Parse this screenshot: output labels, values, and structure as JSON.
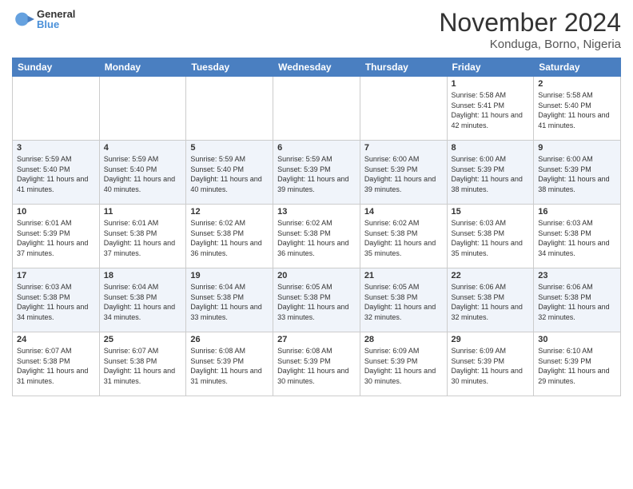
{
  "header": {
    "logo": {
      "general": "General",
      "blue": "Blue"
    },
    "title": "November 2024",
    "location": "Konduga, Borno, Nigeria"
  },
  "weekdays": [
    "Sunday",
    "Monday",
    "Tuesday",
    "Wednesday",
    "Thursday",
    "Friday",
    "Saturday"
  ],
  "weeks": [
    [
      {
        "day": "",
        "empty": true
      },
      {
        "day": "",
        "empty": true
      },
      {
        "day": "",
        "empty": true
      },
      {
        "day": "",
        "empty": true
      },
      {
        "day": "",
        "empty": true
      },
      {
        "day": "1",
        "sunrise": "5:58 AM",
        "sunset": "5:41 PM",
        "daylight": "11 hours and 42 minutes."
      },
      {
        "day": "2",
        "sunrise": "5:58 AM",
        "sunset": "5:40 PM",
        "daylight": "11 hours and 41 minutes."
      }
    ],
    [
      {
        "day": "3",
        "sunrise": "5:59 AM",
        "sunset": "5:40 PM",
        "daylight": "11 hours and 41 minutes."
      },
      {
        "day": "4",
        "sunrise": "5:59 AM",
        "sunset": "5:40 PM",
        "daylight": "11 hours and 40 minutes."
      },
      {
        "day": "5",
        "sunrise": "5:59 AM",
        "sunset": "5:40 PM",
        "daylight": "11 hours and 40 minutes."
      },
      {
        "day": "6",
        "sunrise": "5:59 AM",
        "sunset": "5:39 PM",
        "daylight": "11 hours and 39 minutes."
      },
      {
        "day": "7",
        "sunrise": "6:00 AM",
        "sunset": "5:39 PM",
        "daylight": "11 hours and 39 minutes."
      },
      {
        "day": "8",
        "sunrise": "6:00 AM",
        "sunset": "5:39 PM",
        "daylight": "11 hours and 38 minutes."
      },
      {
        "day": "9",
        "sunrise": "6:00 AM",
        "sunset": "5:39 PM",
        "daylight": "11 hours and 38 minutes."
      }
    ],
    [
      {
        "day": "10",
        "sunrise": "6:01 AM",
        "sunset": "5:39 PM",
        "daylight": "11 hours and 37 minutes."
      },
      {
        "day": "11",
        "sunrise": "6:01 AM",
        "sunset": "5:38 PM",
        "daylight": "11 hours and 37 minutes."
      },
      {
        "day": "12",
        "sunrise": "6:02 AM",
        "sunset": "5:38 PM",
        "daylight": "11 hours and 36 minutes."
      },
      {
        "day": "13",
        "sunrise": "6:02 AM",
        "sunset": "5:38 PM",
        "daylight": "11 hours and 36 minutes."
      },
      {
        "day": "14",
        "sunrise": "6:02 AM",
        "sunset": "5:38 PM",
        "daylight": "11 hours and 35 minutes."
      },
      {
        "day": "15",
        "sunrise": "6:03 AM",
        "sunset": "5:38 PM",
        "daylight": "11 hours and 35 minutes."
      },
      {
        "day": "16",
        "sunrise": "6:03 AM",
        "sunset": "5:38 PM",
        "daylight": "11 hours and 34 minutes."
      }
    ],
    [
      {
        "day": "17",
        "sunrise": "6:03 AM",
        "sunset": "5:38 PM",
        "daylight": "11 hours and 34 minutes."
      },
      {
        "day": "18",
        "sunrise": "6:04 AM",
        "sunset": "5:38 PM",
        "daylight": "11 hours and 34 minutes."
      },
      {
        "day": "19",
        "sunrise": "6:04 AM",
        "sunset": "5:38 PM",
        "daylight": "11 hours and 33 minutes."
      },
      {
        "day": "20",
        "sunrise": "6:05 AM",
        "sunset": "5:38 PM",
        "daylight": "11 hours and 33 minutes."
      },
      {
        "day": "21",
        "sunrise": "6:05 AM",
        "sunset": "5:38 PM",
        "daylight": "11 hours and 32 minutes."
      },
      {
        "day": "22",
        "sunrise": "6:06 AM",
        "sunset": "5:38 PM",
        "daylight": "11 hours and 32 minutes."
      },
      {
        "day": "23",
        "sunrise": "6:06 AM",
        "sunset": "5:38 PM",
        "daylight": "11 hours and 32 minutes."
      }
    ],
    [
      {
        "day": "24",
        "sunrise": "6:07 AM",
        "sunset": "5:38 PM",
        "daylight": "11 hours and 31 minutes."
      },
      {
        "day": "25",
        "sunrise": "6:07 AM",
        "sunset": "5:38 PM",
        "daylight": "11 hours and 31 minutes."
      },
      {
        "day": "26",
        "sunrise": "6:08 AM",
        "sunset": "5:39 PM",
        "daylight": "11 hours and 31 minutes."
      },
      {
        "day": "27",
        "sunrise": "6:08 AM",
        "sunset": "5:39 PM",
        "daylight": "11 hours and 30 minutes."
      },
      {
        "day": "28",
        "sunrise": "6:09 AM",
        "sunset": "5:39 PM",
        "daylight": "11 hours and 30 minutes."
      },
      {
        "day": "29",
        "sunrise": "6:09 AM",
        "sunset": "5:39 PM",
        "daylight": "11 hours and 30 minutes."
      },
      {
        "day": "30",
        "sunrise": "6:10 AM",
        "sunset": "5:39 PM",
        "daylight": "11 hours and 29 minutes."
      }
    ]
  ]
}
